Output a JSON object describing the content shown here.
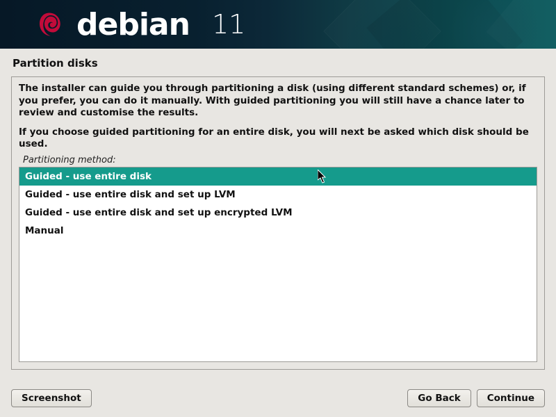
{
  "banner": {
    "brand": "debian",
    "version": "11"
  },
  "page_title": "Partition disks",
  "instructions": {
    "p1": "The installer can guide you through partitioning a disk (using different standard schemes) or, if you prefer, you can do it manually. With guided partitioning you will still have a chance later to review and customise the results.",
    "p2": "If you choose guided partitioning for an entire disk, you will next be asked which disk should be used."
  },
  "field_label": "Partitioning method:",
  "options": [
    {
      "label": "Guided - use entire disk",
      "selected": true
    },
    {
      "label": "Guided - use entire disk and set up LVM",
      "selected": false
    },
    {
      "label": "Guided - use entire disk and set up encrypted LVM",
      "selected": false
    },
    {
      "label": "Manual",
      "selected": false
    }
  ],
  "buttons": {
    "screenshot": "Screenshot",
    "go_back": "Go Back",
    "continue": "Continue"
  }
}
